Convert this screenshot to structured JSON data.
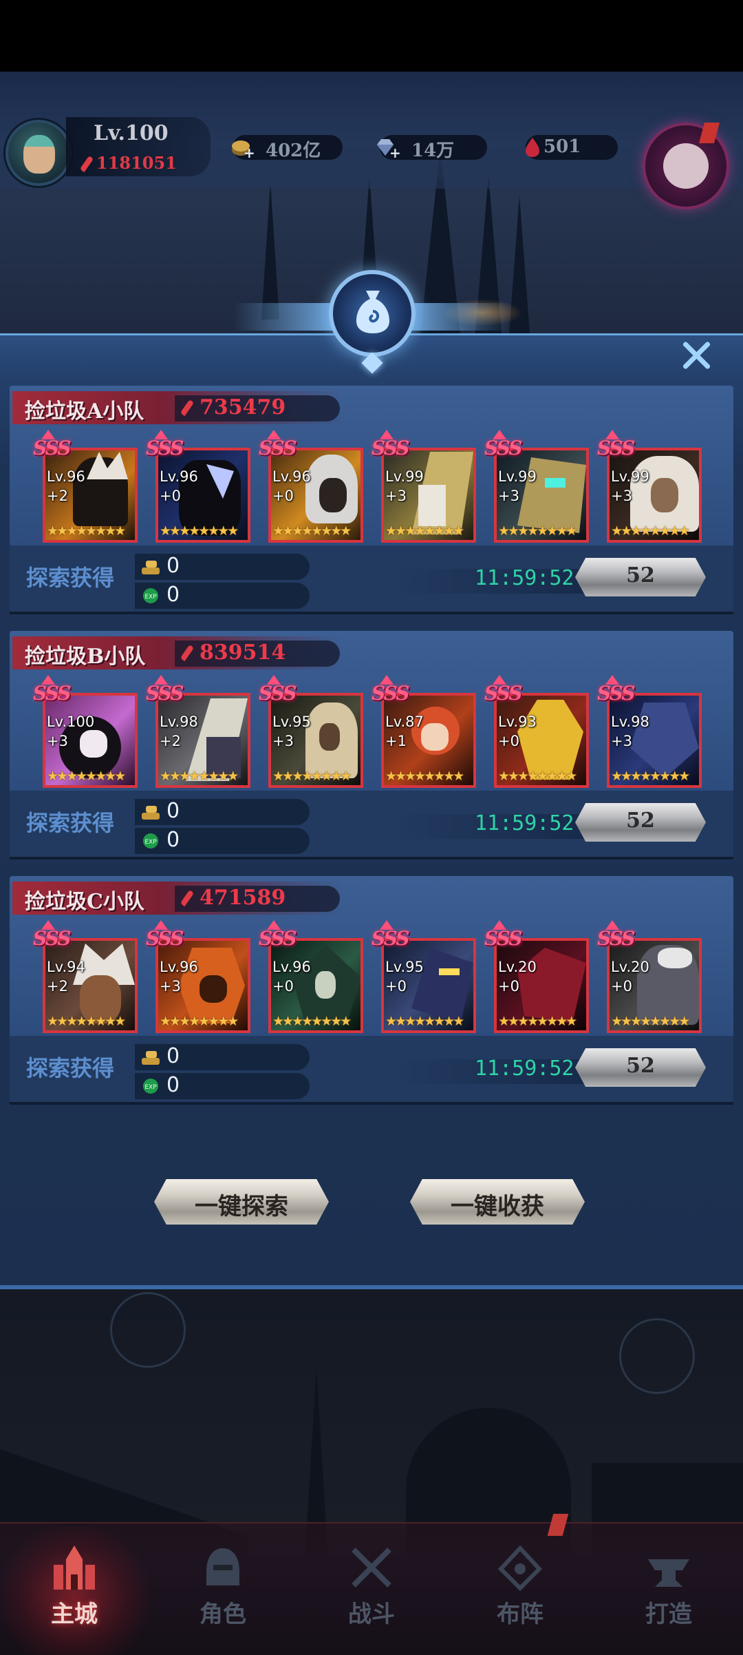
{
  "player": {
    "level": "Lv.100",
    "power": "1181051"
  },
  "resources": {
    "gold": "402亿",
    "diamonds": "14万",
    "gems": "501"
  },
  "teams": [
    {
      "name": "捡垃圾A小队",
      "power": "735479",
      "heroes": [
        {
          "rank": "SSS",
          "level": "Lv.96",
          "plus": "+2",
          "stars": "★★★★★★★★"
        },
        {
          "rank": "SSS",
          "level": "Lv.96",
          "plus": "+0",
          "stars": "★★★★★★★★"
        },
        {
          "rank": "SSS",
          "level": "Lv.96",
          "plus": "+0",
          "stars": "★★★★★★★★"
        },
        {
          "rank": "SSS",
          "level": "Lv.99",
          "plus": "+3",
          "stars": "★★★★★★★★"
        },
        {
          "rank": "SSS",
          "level": "Lv.99",
          "plus": "+3",
          "stars": "★★★★★★★★"
        },
        {
          "rank": "SSS",
          "level": "Lv.99",
          "plus": "+3",
          "stars": "★★★★★★★★"
        }
      ],
      "reward_label": "探索获得",
      "gold": "0",
      "exp": "0",
      "timer": "11:59:52",
      "count": "52"
    },
    {
      "name": "捡垃圾B小队",
      "power": "839514",
      "heroes": [
        {
          "rank": "SSS",
          "level": "Lv.100",
          "plus": "+3",
          "stars": "★★★★★★★★"
        },
        {
          "rank": "SSS",
          "level": "Lv.98",
          "plus": "+2",
          "stars": "★★★★★★★★"
        },
        {
          "rank": "SSS",
          "level": "Lv.95",
          "plus": "+3",
          "stars": "★★★★★★★★"
        },
        {
          "rank": "SSS",
          "level": "Lv.87",
          "plus": "+1",
          "stars": "★★★★★★★★"
        },
        {
          "rank": "SSS",
          "level": "Lv.93",
          "plus": "+0",
          "stars": "★★★★★★★★"
        },
        {
          "rank": "SSS",
          "level": "Lv.98",
          "plus": "+3",
          "stars": "★★★★★★★★"
        }
      ],
      "reward_label": "探索获得",
      "gold": "0",
      "exp": "0",
      "timer": "11:59:52",
      "count": "52"
    },
    {
      "name": "捡垃圾C小队",
      "power": "471589",
      "heroes": [
        {
          "rank": "SSS",
          "level": "Lv.94",
          "plus": "+2",
          "stars": "★★★★★★★★"
        },
        {
          "rank": "SSS",
          "level": "Lv.96",
          "plus": "+3",
          "stars": "★★★★★★★★"
        },
        {
          "rank": "SSS",
          "level": "Lv.96",
          "plus": "+0",
          "stars": "★★★★★★★★"
        },
        {
          "rank": "SSS",
          "level": "Lv.95",
          "plus": "+0",
          "stars": "★★★★★★★★"
        },
        {
          "rank": "SSS",
          "level": "Lv.20",
          "plus": "+0",
          "stars": "★★★★★★★★"
        },
        {
          "rank": "SSS",
          "level": "Lv.20",
          "plus": "+0",
          "stars": "★★★★★★★★"
        }
      ],
      "reward_label": "探索获得",
      "gold": "0",
      "exp": "0",
      "timer": "11:59:52",
      "count": "52"
    }
  ],
  "actions": {
    "explore_all": "一键探索",
    "collect_all": "一键收获"
  },
  "nav": [
    {
      "label": "主城",
      "icon": "castle-icon",
      "active": true
    },
    {
      "label": "角色",
      "icon": "helmet-icon",
      "active": false
    },
    {
      "label": "战斗",
      "icon": "crossed-swords-icon",
      "active": false
    },
    {
      "label": "布阵",
      "icon": "formation-icon",
      "active": false
    },
    {
      "label": "打造",
      "icon": "anvil-icon",
      "active": false
    }
  ],
  "colors": {
    "accent_red": "#e23a45",
    "timer_green": "#2fd3a6",
    "panel_blue": "#2d4c7d",
    "rank_pink": "#ff5f86",
    "star_gold": "#f5c24a"
  }
}
